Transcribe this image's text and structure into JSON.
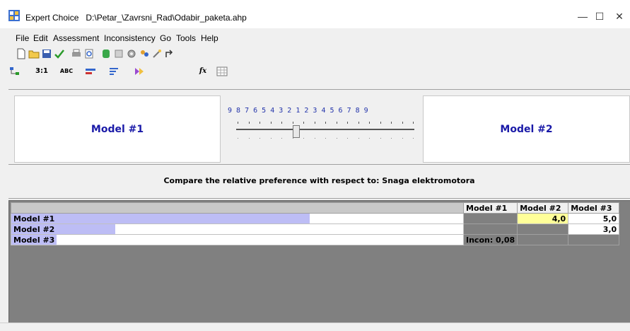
{
  "window": {
    "app_name": "Expert Choice",
    "file_path": "D:\\Petar_\\Zavrsni_Rad\\Odabir_paketa.ahp",
    "minimize": "—",
    "maximize": "☐",
    "close": "✕"
  },
  "menu": [
    "File",
    "Edit",
    "Assessment",
    "Inconsistency",
    "Go",
    "Tools",
    "Help"
  ],
  "tabs": {
    "tab2": "3:1",
    "tab3": "ABC",
    "tab6": "fx"
  },
  "comparison": {
    "left_model": "Model #1",
    "right_model": "Model #2",
    "scale_labels": "9 8 7 6 5 4 3 2 1 2 3 4 5 6 7 8 9"
  },
  "prompt": "Compare the relative preference with respect to: Snaga elektromotora",
  "grid": {
    "columns": [
      "Model #1",
      "Model #2",
      "Model #3"
    ],
    "rows": [
      {
        "name": "Model #1",
        "bar_fraction": 0.66,
        "cells": [
          "",
          "4,0",
          "5,0"
        ]
      },
      {
        "name": "Model #2",
        "bar_fraction": 0.23,
        "cells": [
          "",
          "",
          "3,0"
        ]
      },
      {
        "name": "Model #3",
        "bar_fraction": 0.1,
        "cells": [
          "Incon: 0,08",
          "",
          ""
        ]
      }
    ]
  },
  "colors": {
    "model_text": "#1a1aa8",
    "bar": "#bdbdf5",
    "selected_cell": "#ffff99",
    "grid_bg": "#808080"
  }
}
